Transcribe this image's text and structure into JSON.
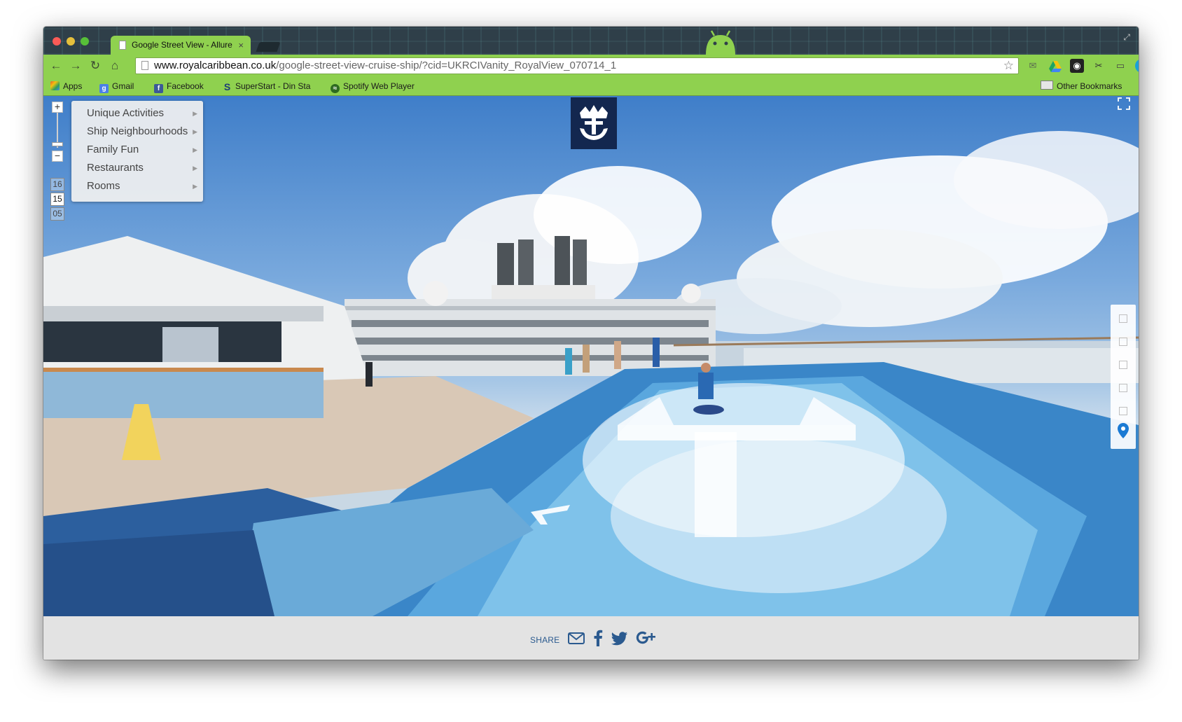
{
  "tab": {
    "title": "Google Street View - Allure",
    "close": "×"
  },
  "address": {
    "host": "www.royalcaribbean.co.uk",
    "path": "/google-street-view-cruise-ship/?cid=UKRCIVanity_RoyalView_070714_1"
  },
  "bookmarks": {
    "items": [
      {
        "label": "Apps",
        "icon": "apps-grid-icon",
        "color": "#e65c2e"
      },
      {
        "label": "Gmail",
        "icon": "google-icon",
        "color": "#4a80e8"
      },
      {
        "label": "Facebook",
        "icon": "facebook-icon",
        "color": "#3b5998"
      },
      {
        "label": "SuperStart - Din Sta",
        "icon": "superstart-icon",
        "color": "#1e3c78"
      },
      {
        "label": "Spotify Web Player",
        "icon": "spotify-icon",
        "color": "#2e6b20"
      }
    ],
    "other": "Other Bookmarks"
  },
  "menu": {
    "items": [
      {
        "label": "Unique Activities"
      },
      {
        "label": "Ship Neighbourhoods"
      },
      {
        "label": "Family Fun"
      },
      {
        "label": "Restaurants"
      },
      {
        "label": "Rooms"
      }
    ]
  },
  "zoom": {
    "in": "+",
    "out": "−"
  },
  "decks": [
    {
      "label": "16",
      "active": false
    },
    {
      "label": "15",
      "active": true
    },
    {
      "label": "05",
      "active": false
    }
  ],
  "share": {
    "label": "SHARE",
    "icons": [
      "email-icon",
      "facebook-icon",
      "twitter-icon",
      "google-plus-icon"
    ]
  },
  "colors": {
    "chrome_green": "#8fd14f",
    "brand_navy": "#13274f",
    "share_blue": "#2b5a8f",
    "pin_blue": "#1a7ad4"
  }
}
